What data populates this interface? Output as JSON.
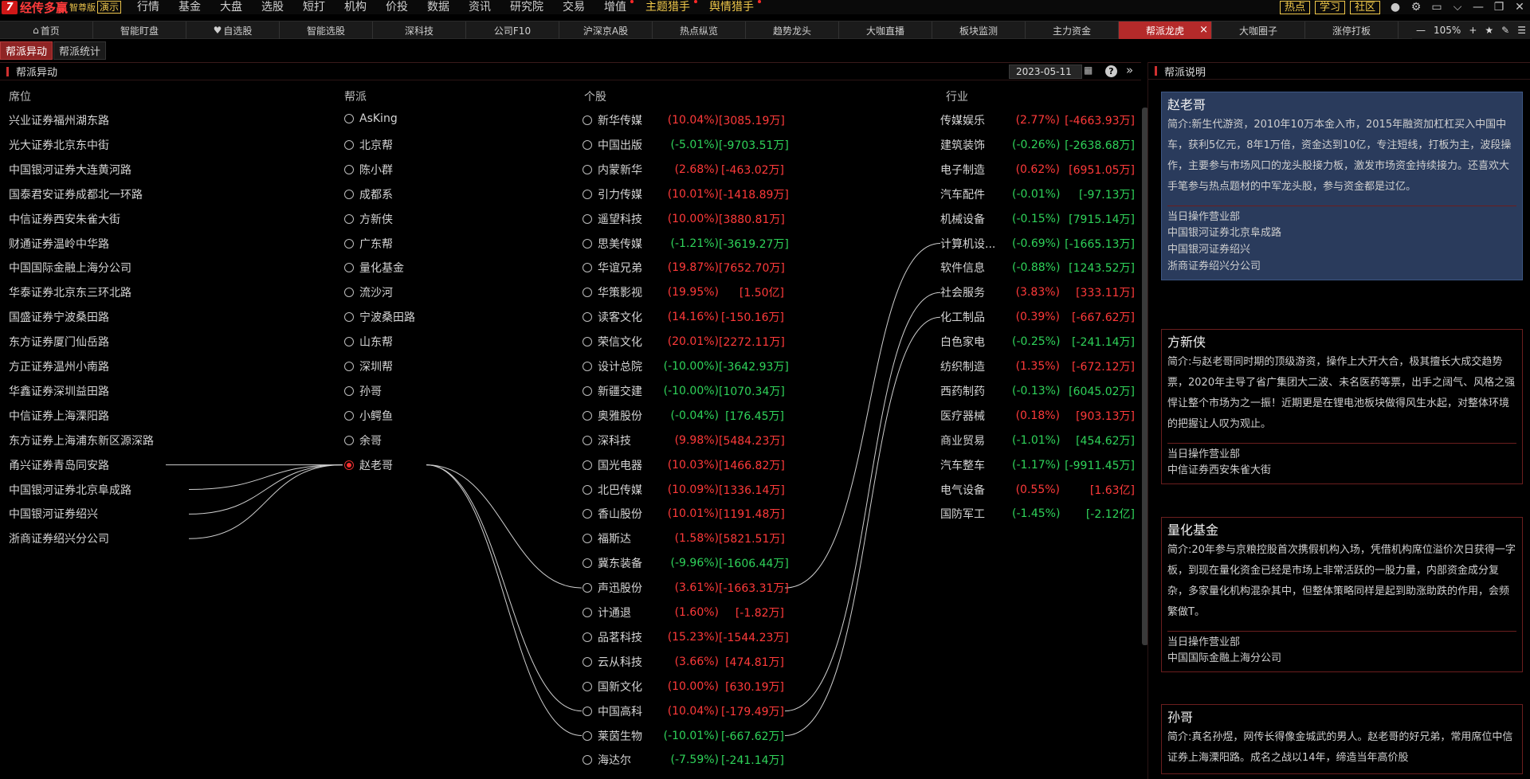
{
  "app": {
    "logo_mark": "7",
    "name": "经传多赢",
    "edition": "智尊版",
    "demo": "演示"
  },
  "menu": [
    {
      "label": "行情",
      "hl": false,
      "dot": false
    },
    {
      "label": "基金",
      "hl": false,
      "dot": false
    },
    {
      "label": "大盘",
      "hl": false,
      "dot": false
    },
    {
      "label": "选股",
      "hl": false,
      "dot": false
    },
    {
      "label": "短打",
      "hl": false,
      "dot": false
    },
    {
      "label": "机构",
      "hl": false,
      "dot": false
    },
    {
      "label": "价投",
      "hl": false,
      "dot": false
    },
    {
      "label": "数据",
      "hl": false,
      "dot": false
    },
    {
      "label": "资讯",
      "hl": false,
      "dot": false
    },
    {
      "label": "研究院",
      "hl": false,
      "dot": false
    },
    {
      "label": "交易",
      "hl": false,
      "dot": false
    },
    {
      "label": "增值",
      "hl": false,
      "dot": true
    },
    {
      "label": "主题猎手",
      "hl": true,
      "dot": true
    },
    {
      "label": "舆情猎手",
      "hl": true,
      "dot": true
    }
  ],
  "top_right": {
    "btn_hot": "热点",
    "btn_learn": "学习",
    "btn_community": "社区",
    "icons": [
      "user-icon",
      "gear-icon",
      "window-icon",
      "chevron-down-icon",
      "minimize-icon",
      "restore-icon",
      "close-icon"
    ],
    "icon_glyphs": [
      "●",
      "⚙",
      "▭",
      "⌵",
      "—",
      "❐",
      "✕"
    ]
  },
  "tabs": [
    {
      "label": "首页",
      "icon": "home-icon"
    },
    {
      "label": "智能盯盘"
    },
    {
      "label": "自选股",
      "icon": "heart-icon"
    },
    {
      "label": "智能选股"
    },
    {
      "label": "深科技"
    },
    {
      "label": "公司F10"
    },
    {
      "label": "沪深京A股"
    },
    {
      "label": "热点纵览"
    },
    {
      "label": "趋势龙头"
    },
    {
      "label": "大咖直播"
    },
    {
      "label": "板块监测"
    },
    {
      "label": "主力资金"
    },
    {
      "label": "帮派龙虎",
      "active": true
    },
    {
      "label": "大咖圈子"
    },
    {
      "label": "涨停打板"
    }
  ],
  "zoom": {
    "minus": "—",
    "level": "105%",
    "plus": "+"
  },
  "subtabs": [
    {
      "label": "帮派异动",
      "active": true
    },
    {
      "label": "帮派统计",
      "active": false
    }
  ],
  "left": {
    "title": "帮派异动",
    "date": "2023-05-11",
    "help": "?",
    "expand": "»",
    "headers": {
      "seat": "席位",
      "faction": "帮派",
      "stock": "个股",
      "industry": "行业"
    },
    "seats": [
      "兴业证券福州湖东路",
      "光大证券北京东中街",
      "中国银河证券大连黄河路",
      "国泰君安证券成都北一环路",
      "中信证券西安朱雀大街",
      "财通证券温岭中华路",
      "中国国际金融上海分公司",
      "华泰证券北京东三环北路",
      "国盛证券宁波桑田路",
      "东方证券厦门仙岳路",
      "方正证券温州小南路",
      "华鑫证券深圳益田路",
      "中信证券上海溧阳路",
      "东方证券上海浦东新区源深路",
      "甬兴证券青岛同安路",
      "中国银河证券北京阜成路",
      "中国银河证券绍兴",
      "浙商证券绍兴分公司"
    ],
    "factions": [
      {
        "name": "AsKing"
      },
      {
        "name": "北京帮"
      },
      {
        "name": "陈小群"
      },
      {
        "name": "成都系"
      },
      {
        "name": "方新侠"
      },
      {
        "name": "广东帮"
      },
      {
        "name": "量化基金"
      },
      {
        "name": "流沙河"
      },
      {
        "name": "宁波桑田路"
      },
      {
        "name": "山东帮"
      },
      {
        "name": "深圳帮"
      },
      {
        "name": "孙哥"
      },
      {
        "name": "小鳄鱼"
      },
      {
        "name": "余哥"
      },
      {
        "name": "赵老哥",
        "selected": true
      }
    ],
    "stocks": [
      {
        "name": "新华传媒",
        "pct": "(10.04%)",
        "amt": "[3085.19万]",
        "up": true
      },
      {
        "name": "中国出版",
        "pct": "(-5.01%)",
        "amt": "[-9703.51万]",
        "up": false
      },
      {
        "name": "内蒙新华",
        "pct": "(2.68%)",
        "amt": "[-463.02万]",
        "up": true
      },
      {
        "name": "引力传媒",
        "pct": "(10.01%)",
        "amt": "[-1418.89万]",
        "up": true
      },
      {
        "name": "遥望科技",
        "pct": "(10.00%)",
        "amt": "[3880.81万]",
        "up": true
      },
      {
        "name": "思美传媒",
        "pct": "(-1.21%)",
        "amt": "[-3619.27万]",
        "up": false
      },
      {
        "name": "华谊兄弟",
        "pct": "(19.87%)",
        "amt": "[7652.70万]",
        "up": true
      },
      {
        "name": "华策影视",
        "pct": "(19.95%)",
        "amt": "[1.50亿]",
        "up": true
      },
      {
        "name": "读客文化",
        "pct": "(14.16%)",
        "amt": "[-150.16万]",
        "up": true
      },
      {
        "name": "荣信文化",
        "pct": "(20.01%)",
        "amt": "[2272.11万]",
        "up": true
      },
      {
        "name": "设计总院",
        "pct": "(-10.00%)",
        "amt": "[-3642.93万]",
        "up": false
      },
      {
        "name": "新疆交建",
        "pct": "(-10.00%)",
        "amt": "[1070.34万]",
        "up": false
      },
      {
        "name": "奥雅股份",
        "pct": "(-0.04%)",
        "amt": "[176.45万]",
        "up": false
      },
      {
        "name": "深科技",
        "pct": "(9.98%)",
        "amt": "[5484.23万]",
        "up": true
      },
      {
        "name": "国光电器",
        "pct": "(10.03%)",
        "amt": "[1466.82万]",
        "up": true
      },
      {
        "name": "北巴传媒",
        "pct": "(10.09%)",
        "amt": "[1336.14万]",
        "up": true
      },
      {
        "name": "香山股份",
        "pct": "(10.01%)",
        "amt": "[1191.48万]",
        "up": true
      },
      {
        "name": "福斯达",
        "pct": "(1.58%)",
        "amt": "[5821.51万]",
        "up": true
      },
      {
        "name": "冀东装备",
        "pct": "(-9.96%)",
        "amt": "[-1606.44万]",
        "up": false
      },
      {
        "name": "声迅股份",
        "pct": "(3.61%)",
        "amt": "[-1663.31万]",
        "up": true
      },
      {
        "name": "计通退",
        "pct": "(1.60%)",
        "amt": "[-1.82万]",
        "up": true
      },
      {
        "name": "品茗科技",
        "pct": "(15.23%)",
        "amt": "[-1544.23万]",
        "up": true
      },
      {
        "name": "云从科技",
        "pct": "(3.66%)",
        "amt": "[474.81万]",
        "up": true
      },
      {
        "name": "国新文化",
        "pct": "(10.00%)",
        "amt": "[630.19万]",
        "up": true
      },
      {
        "name": "中国高科",
        "pct": "(10.04%)",
        "amt": "[-179.49万]",
        "up": true
      },
      {
        "name": "莱茵生物",
        "pct": "(-10.01%)",
        "amt": "[-667.62万]",
        "up": false
      },
      {
        "name": "海达尔",
        "pct": "(-7.59%)",
        "amt": "[-241.14万]",
        "up": false
      }
    ],
    "industries": [
      {
        "name": "传媒娱乐",
        "pct": "(2.77%)",
        "amt": "[-4663.93万]",
        "up": true
      },
      {
        "name": "建筑装饰",
        "pct": "(-0.26%)",
        "amt": "[-2638.68万]",
        "up": false
      },
      {
        "name": "电子制造",
        "pct": "(0.62%)",
        "amt": "[6951.05万]",
        "up": true
      },
      {
        "name": "汽车配件",
        "pct": "(-0.01%)",
        "amt": "[-97.13万]",
        "up": false
      },
      {
        "name": "机械设备",
        "pct": "(-0.15%)",
        "amt": "[7915.14万]",
        "up": false
      },
      {
        "name": "计算机设...",
        "pct": "(-0.69%)",
        "amt": "[-1665.13万]",
        "up": false
      },
      {
        "name": "软件信息",
        "pct": "(-0.88%)",
        "amt": "[1243.52万]",
        "up": false
      },
      {
        "name": "社会服务",
        "pct": "(3.83%)",
        "amt": "[333.11万]",
        "up": true
      },
      {
        "name": "化工制品",
        "pct": "(0.39%)",
        "amt": "[-667.62万]",
        "up": true
      },
      {
        "name": "白色家电",
        "pct": "(-0.25%)",
        "amt": "[-241.14万]",
        "up": false
      },
      {
        "name": "纺织制造",
        "pct": "(1.35%)",
        "amt": "[-672.12万]",
        "up": true
      },
      {
        "name": "西药制药",
        "pct": "(-0.13%)",
        "amt": "[6045.02万]",
        "up": false
      },
      {
        "name": "医疗器械",
        "pct": "(0.18%)",
        "amt": "[903.13万]",
        "up": true
      },
      {
        "name": "商业贸易",
        "pct": "(-1.01%)",
        "amt": "[454.62万]",
        "up": false
      },
      {
        "name": "汽车整车",
        "pct": "(-1.17%)",
        "amt": "[-9911.45万]",
        "up": false
      },
      {
        "name": "电气设备",
        "pct": "(0.55%)",
        "amt": "[1.63亿]",
        "up": true
      },
      {
        "name": "国防军工",
        "pct": "(-1.45%)",
        "amt": "[-2.12亿]",
        "up": false
      }
    ]
  },
  "right": {
    "title": "帮派说明",
    "cards": [
      {
        "name": "赵老哥",
        "selected": true,
        "desc": "简介:新生代游资，2010年10万本金入市，2015年融资加杠杠买入中国中车，获利5亿元，8年1万倍，资金达到10亿，专注短线，打板为主，波段操作，主要参与市场风口的龙头股接力板，激发市场资金持续接力。还喜欢大手笔参与热点题材的中军龙头股，参与资金都是过亿。",
        "ops_title": "当日操作营业部",
        "ops": [
          "中国银河证券北京阜成路",
          "中国银河证券绍兴",
          "浙商证券绍兴分公司"
        ]
      },
      {
        "name": "方新侠",
        "selected": false,
        "desc": "简介:与赵老哥同时期的顶级游资，操作上大开大合，极其擅长大成交趋势票，2020年主导了省广集团大二波、未名医药等票，出手之阔气、风格之强悍让整个市场为之一振！近期更是在锂电池板块做得风生水起，对整体环境的把握让人叹为观止。",
        "ops_title": "当日操作营业部",
        "ops": [
          "中信证券西安朱雀大街"
        ]
      },
      {
        "name": "量化基金",
        "selected": false,
        "desc": "简介:20年参与京粮控股首次携假机构入场，凭借机构席位溢价次日获得一字板，到现在量化资金已经是市场上非常活跃的一股力量，内部资金成分复杂，多家量化机构混杂其中，但整体策略同样是起到助涨助跌的作用，会频繁做T。",
        "ops_title": "当日操作营业部",
        "ops": [
          "中国国际金融上海分公司"
        ]
      },
      {
        "name": "孙哥",
        "selected": false,
        "desc": "简介:真名孙煜，网传长得像金城武的男人。赵老哥的好兄弟，常用席位中信证券上海溧阳路。成名之战以14年，缔造当年高价股",
        "ops_title": "",
        "ops": []
      }
    ]
  }
}
